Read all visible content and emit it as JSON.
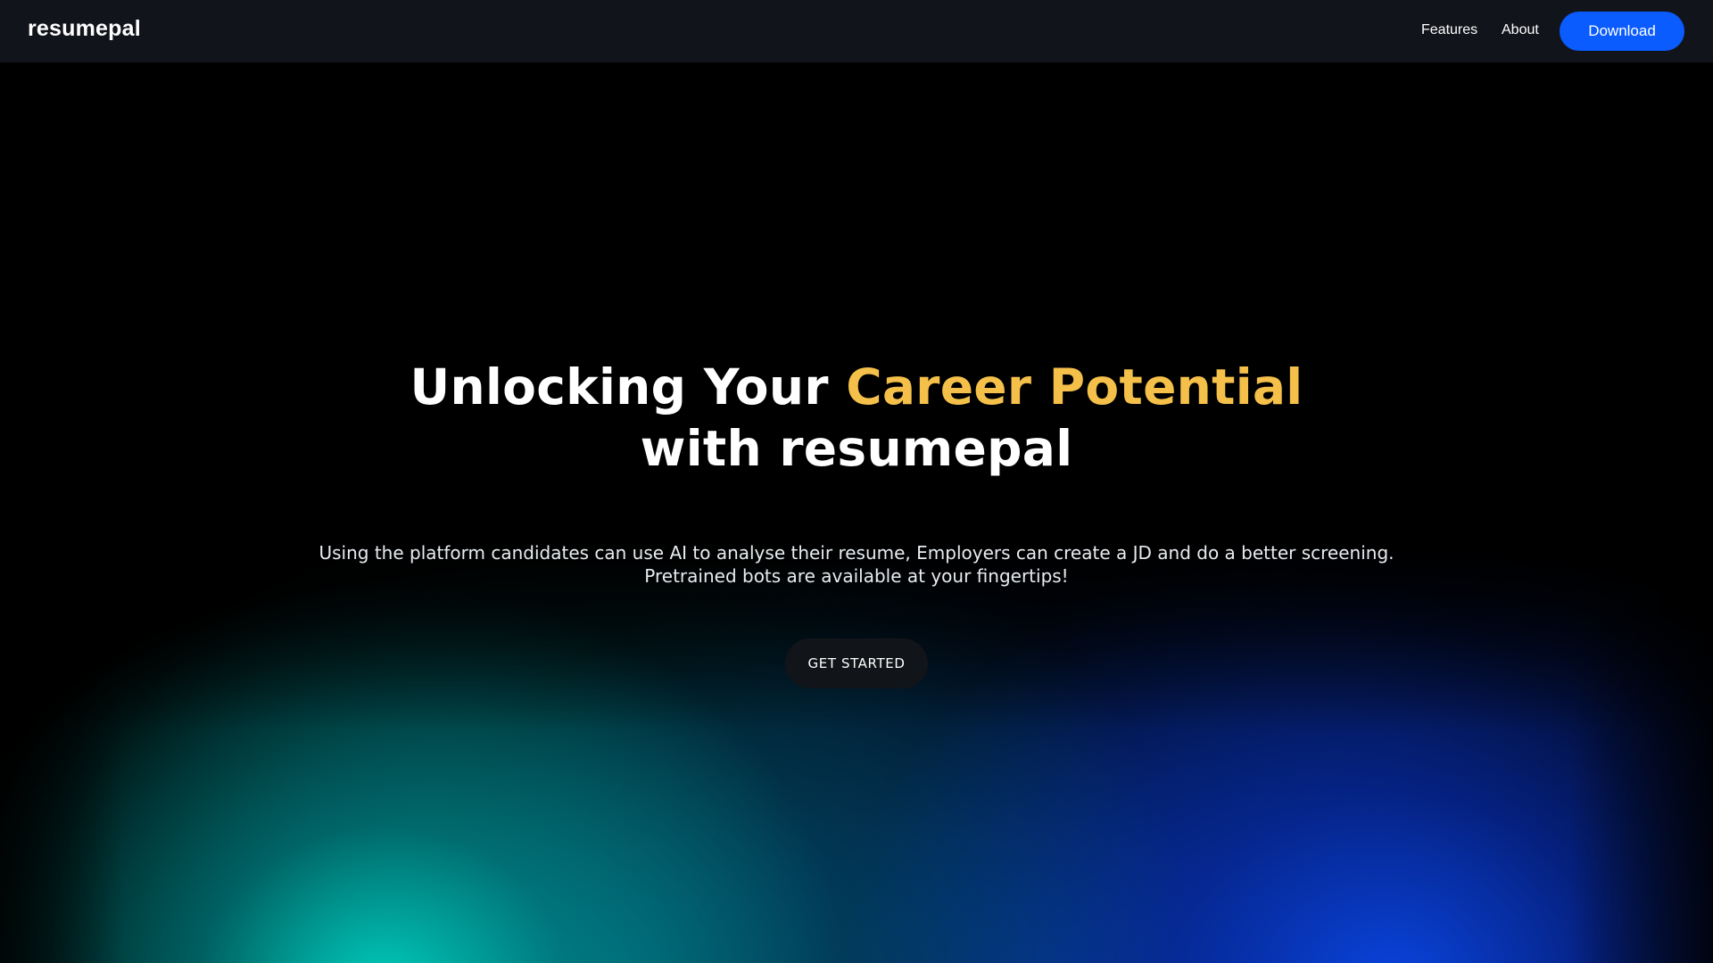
{
  "navbar": {
    "logo": "resumepal",
    "links": [
      {
        "label": "Features"
      },
      {
        "label": "About"
      }
    ],
    "download_label": "Download"
  },
  "hero": {
    "headline_part1": "Unlocking Your ",
    "headline_accent": "Career Potential",
    "headline_line2": "with resumepal",
    "subtitle": "Using the platform candidates can use AI to analyse their resume, Employers can create a JD and do a better screening. Pretrained bots are available at your fingertips!",
    "cta_label": "GET STARTED"
  },
  "colors": {
    "navbar_bg": "#12141b",
    "accent": "#f5c04a",
    "download_button": "#0a5cff",
    "glow_teal": "#00d6c4",
    "glow_blue": "#0a46e6"
  }
}
